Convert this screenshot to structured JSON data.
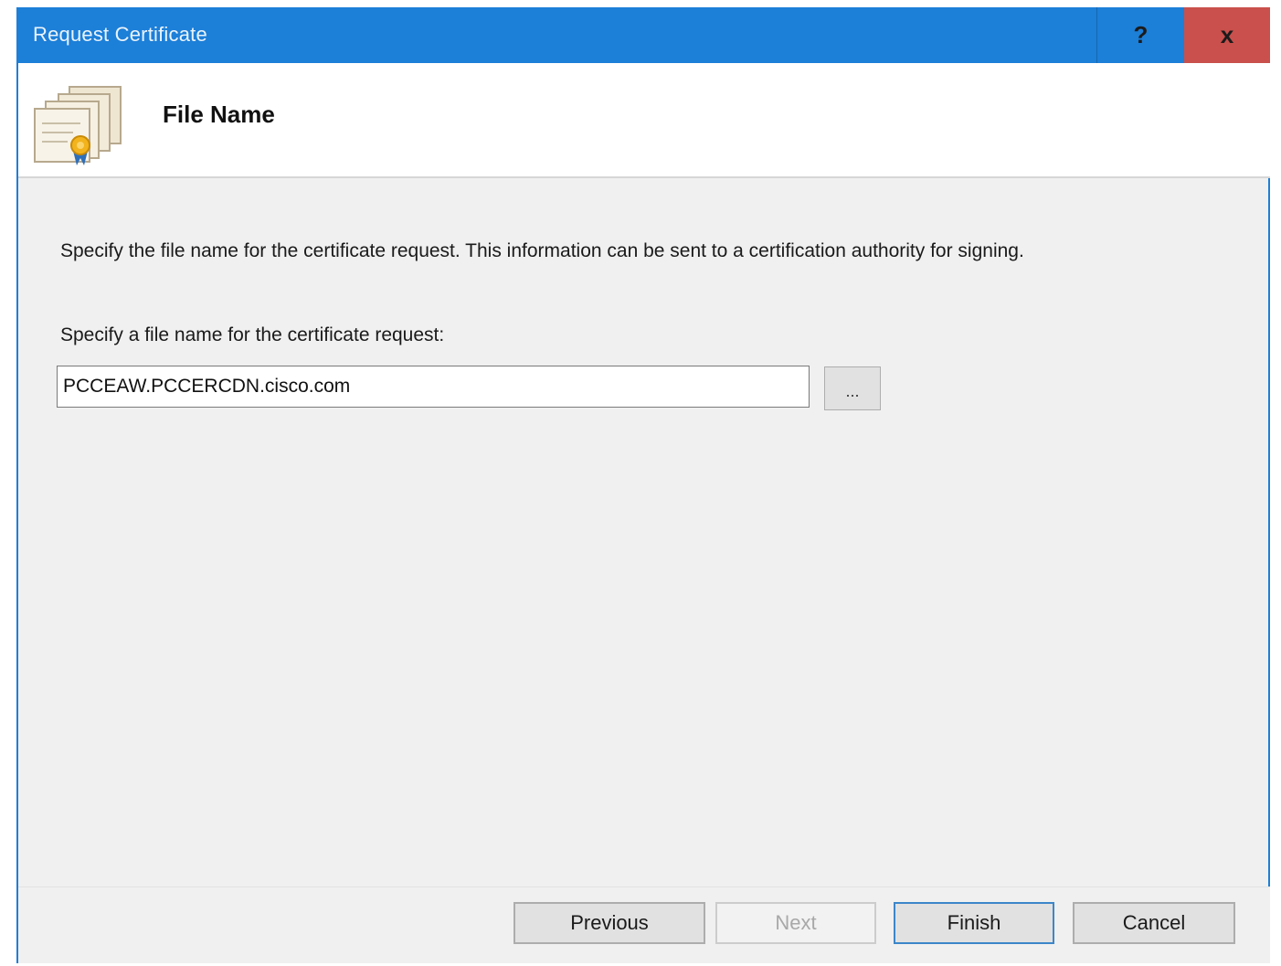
{
  "window": {
    "title": "Request Certificate",
    "help_label": "?",
    "close_label": "x"
  },
  "header": {
    "title": "File Name"
  },
  "content": {
    "description": "Specify the file name for the certificate request. This information can be sent to a certification authority for signing.",
    "field_label": "Specify a file name for the certificate request:",
    "filename_value": "PCCEAW.PCCERCDN.cisco.com",
    "browse_label": "..."
  },
  "footer": {
    "previous_label": "Previous",
    "next_label": "Next",
    "finish_label": "Finish",
    "cancel_label": "Cancel"
  },
  "icons": {
    "header": "certificate-stack-icon"
  },
  "colors": {
    "titlebar": "#1c7fd8",
    "close": "#c9504c"
  }
}
